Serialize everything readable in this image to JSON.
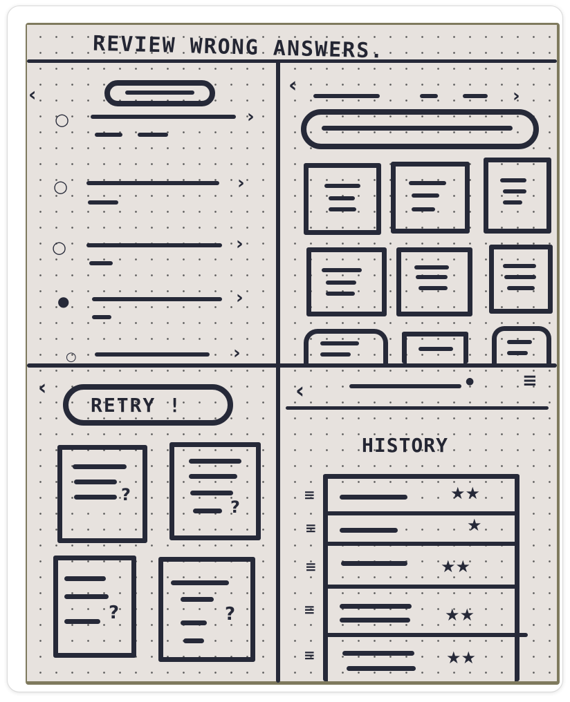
{
  "frame": {
    "title": "REVIEW WRONG ANSWERS.",
    "retry_label": "RETRY !",
    "history_label": "HISTORY",
    "colors": {
      "ink": "#262938",
      "paper": "#e7e2de",
      "background": "#7f7a5e"
    }
  },
  "icons": {
    "back": "back-chevron-icon",
    "next": "next-chevron-icon",
    "question": "question-mark-icon",
    "star": "star-icon",
    "menu": "hamburger-menu-icon"
  }
}
